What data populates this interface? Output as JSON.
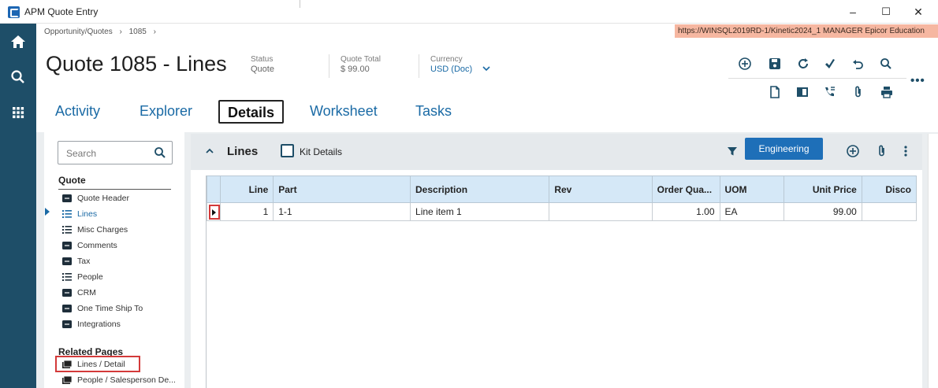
{
  "window": {
    "title": "APM Quote Entry",
    "minimize": "–",
    "maximize": "☐",
    "close": "✕"
  },
  "breadcrumb": [
    "Opportunity/Quotes",
    "›",
    "1085",
    "›"
  ],
  "environment": "https://WINSQL2019RD-1/Kinetic2024_1   MANAGER   Epicor Education",
  "header": {
    "title": "Quote 1085 - Lines",
    "status_label": "Status",
    "status_value": "Quote",
    "total_label": "Quote Total",
    "total_value": "$   99.00",
    "currency_label": "Currency",
    "currency_value": "USD (Doc)",
    "more": "•••"
  },
  "tabs": [
    {
      "label": "Activity"
    },
    {
      "label": "Explorer"
    },
    {
      "label": "Details",
      "active": true
    },
    {
      "label": "Worksheet"
    },
    {
      "label": "Tasks"
    }
  ],
  "nav": {
    "search_placeholder": "Search",
    "section_quote": "Quote",
    "items": [
      {
        "label": "Quote Header",
        "icon": "card-icon"
      },
      {
        "label": "Lines",
        "icon": "list-icon",
        "current": true
      },
      {
        "label": "Misc Charges",
        "icon": "list-icon"
      },
      {
        "label": "Comments",
        "icon": "card-icon"
      },
      {
        "label": "Tax",
        "icon": "card-icon"
      },
      {
        "label": "People",
        "icon": "list-icon"
      },
      {
        "label": "CRM",
        "icon": "card-icon"
      },
      {
        "label": "One Time Ship To",
        "icon": "card-icon"
      },
      {
        "label": "Integrations",
        "icon": "card-icon"
      }
    ],
    "section_related": "Related Pages",
    "related": [
      {
        "label": "Lines / Detail",
        "icon": "pages-icon",
        "highlighted": true
      },
      {
        "label": "People / Salesperson De...",
        "icon": "pages-icon"
      }
    ]
  },
  "lines_panel": {
    "title": "Lines",
    "kit_details_label": "Kit Details",
    "engineering_label": "Engineering",
    "columns": [
      "Line",
      "Part",
      "Description",
      "Rev",
      "Order Qua...",
      "UOM",
      "Unit Price",
      "Disco"
    ],
    "rows": [
      {
        "line": "1",
        "part": "1-1",
        "description": "Line item 1",
        "rev": "",
        "order_qty": "1.00",
        "uom": "EA",
        "unit_price": "99.00",
        "disco": ""
      }
    ]
  },
  "colors": {
    "rail": "#1e4e68",
    "accent": "#1a6aa5",
    "button": "#1e6fb8",
    "highlight": "#d33a3a",
    "env_strip": "#f6b7a1"
  }
}
